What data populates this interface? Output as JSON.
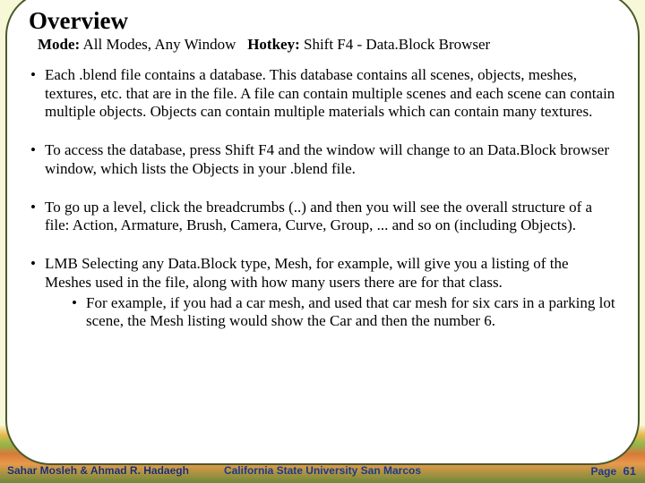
{
  "title": "Overview",
  "subtitle": {
    "mode_label": "Mode:",
    "mode_value": "All Modes, Any Window",
    "hotkey_label": "Hotkey:",
    "hotkey_value": "Shift F4 - Data.Block Browser"
  },
  "bullets": [
    {
      "text": "Each .blend file contains a database. This database contains all scenes, objects, meshes, textures, etc. that are in the file. A file can contain multiple scenes and each scene can contain multiple objects. Objects can contain multiple materials which can contain many textures."
    },
    {
      "text": "To access the database, press Shift F4 and the window will change to an Data.Block browser window, which lists the Objects in your .blend file."
    },
    {
      "text": "To go up a level, click the breadcrumbs (..) and then you will see the overall structure of a file: Action, Armature, Brush, Camera, Curve, Group, ... and so on (including Objects)."
    },
    {
      "text": "LMB Selecting any Data.Block type, Mesh, for example, will give you a listing of the Meshes used in the file, along with how many users there are for that class.",
      "sub": [
        "For example, if you had a car mesh, and used that car mesh for six cars in a parking lot scene, the Mesh listing would show the Car and then the number 6."
      ]
    }
  ],
  "footer": {
    "authors": "Sahar Mosleh & Ahmad R. Hadaegh",
    "university": "California State University San Marcos",
    "page_label": "Page",
    "page_number": "61"
  }
}
